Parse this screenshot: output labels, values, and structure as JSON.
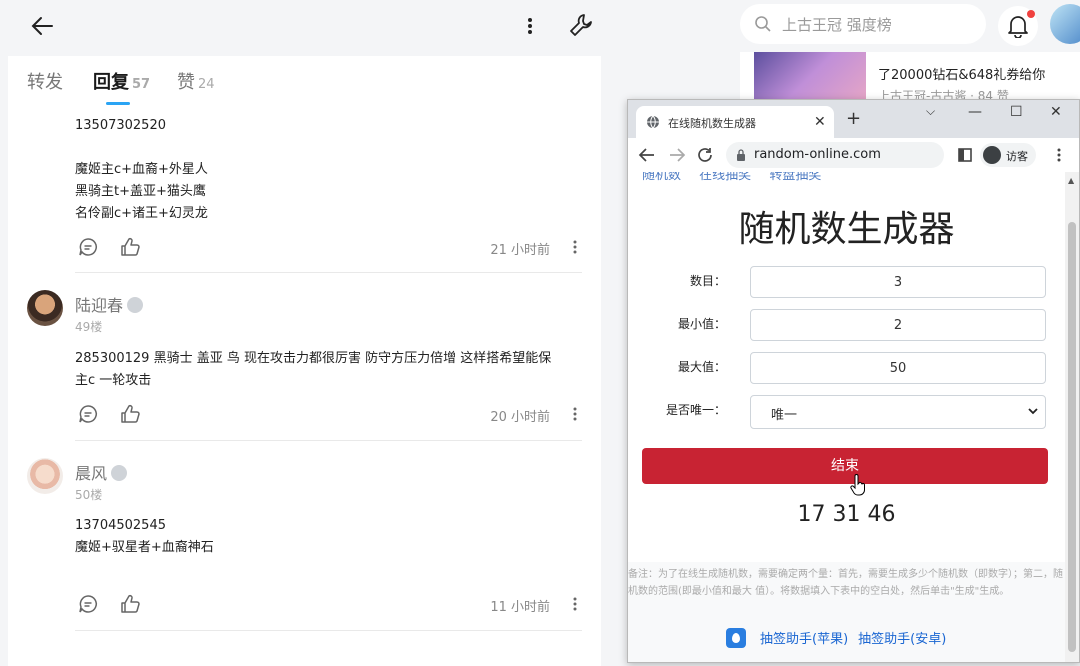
{
  "search": {
    "placeholder": "上古王冠 强度榜"
  },
  "tabs": [
    {
      "label": "转发",
      "count": ""
    },
    {
      "label": "回复",
      "count": "57"
    },
    {
      "label": "赞",
      "count": "24"
    }
  ],
  "comments": [
    {
      "lines": [
        "13507302520",
        "",
        "魔姬主c+血裔+外星人",
        "黑骑主t+盖亚+猫头鹰",
        "名伶副c+诸王+幻灵龙"
      ],
      "time": "21 小时前"
    },
    {
      "user": "陆迎春",
      "floor": "49楼",
      "lines": [
        "285300129 黑骑士 盖亚 鸟  现在攻击力都很厉害 防守方压力倍增 这样搭希望能保",
        "主c 一轮攻击"
      ],
      "time": "20 小时前"
    },
    {
      "user": "晨风",
      "floor": "50楼",
      "lines": [
        "13704502545",
        "魔姬+驭星者+血裔神石"
      ],
      "time": "11 小时前"
    }
  ],
  "feed": {
    "title": "了20000钻石&648礼券给你",
    "meta": "上古王冠-古古酱 · 84 赞"
  },
  "browser": {
    "tab_title": "在线随机数生成器",
    "url": "random-online.com",
    "guest": "访客",
    "top_links": [
      "随机数",
      "在线抽奖",
      "转盘抽奖"
    ],
    "title": "随机数生成器",
    "fields": [
      {
        "label": "数目：",
        "value": "3"
      },
      {
        "label": "最小值：",
        "value": "2"
      },
      {
        "label": "最大值：",
        "value": "50"
      }
    ],
    "unique_label": "是否唯一：",
    "unique_value": "唯一",
    "button": "结束",
    "result": "17 31 46",
    "note": "备注：为了在线生成随机数，需要确定两个量：首先，需要生成多少个随机数（即数字）；第二，随机数的范围(即最小值和最大 值）。将数据填入下表中的空白处，然后单击\"生成\"生成。",
    "links": [
      "抽签助手(苹果)",
      "抽签助手(安卓)"
    ]
  }
}
